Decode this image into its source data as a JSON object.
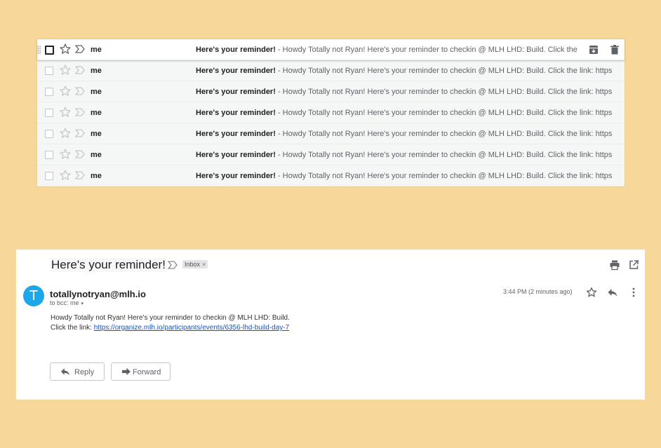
{
  "inbox": {
    "rows": [
      {
        "sender": "me",
        "subject": "Here's your reminder!",
        "snippet": " - Howdy Totally not Ryan! Here's your reminder to checkin @ MLH LHD: Build. Click the link: https://organize.mlh.io/participants/events/6356-lhd-build-day-7"
      },
      {
        "sender": "me",
        "subject": "Here's your reminder!",
        "snippet": " - Howdy Totally not Ryan! Here's your reminder to checkin @ MLH LHD: Build. Click the link: https://organize.mlh.io/participants/events/6356-lhd-build-day-7"
      },
      {
        "sender": "me",
        "subject": "Here's your reminder!",
        "snippet": " - Howdy Totally not Ryan! Here's your reminder to checkin @ MLH LHD: Build. Click the link: https://organize.mlh.io/participants/events/6356-lhd-build-day-7"
      },
      {
        "sender": "me",
        "subject": "Here's your reminder!",
        "snippet": " - Howdy Totally not Ryan! Here's your reminder to checkin @ MLH LHD: Build. Click the link: https://organize.mlh.io/participants/events/6356-lhd-build-day-7"
      },
      {
        "sender": "me",
        "subject": "Here's your reminder!",
        "snippet": " - Howdy Totally not Ryan! Here's your reminder to checkin @ MLH LHD: Build. Click the link: https://organize.mlh.io/participants/events/6356-lhd-build-day-7"
      },
      {
        "sender": "me",
        "subject": "Here's your reminder!",
        "snippet": " - Howdy Totally not Ryan! Here's your reminder to checkin @ MLH LHD: Build. Click the link: https://organize.mlh.io/participants/events/6356-lhd-build-day-7"
      },
      {
        "sender": "me",
        "subject": "Here's your reminder!",
        "snippet": " - Howdy Totally not Ryan! Here's your reminder to checkin @ MLH LHD: Build. Click the link: https://organize.mlh.io/participants/events/6356-lhd-build-day-7"
      }
    ]
  },
  "email": {
    "subject": "Here's your reminder!",
    "label": "Inbox",
    "label_remove": "×",
    "avatar_letter": "T",
    "from": "totallynotryan@mlh.io",
    "to": "to bcc: me",
    "to_caret": "▾",
    "time": "3:44 PM (2 minutes ago)",
    "body_line1": "Howdy Totally not Ryan! Here's your reminder to checkin @ MLH LHD: Build.",
    "body_line2_prefix": "Click the link: ",
    "link": "https://organize.mlh.io/participants/events/6356-lhd-build-day-7",
    "reply_label": "Reply",
    "forward_label": "Forward"
  },
  "colors": {
    "background": "#f8d79a",
    "avatar": "#1ea7e8",
    "link": "#1155cc"
  },
  "icons": [
    "drag-handle-icon",
    "checkbox",
    "star-icon",
    "importance-marker-icon",
    "archive-icon",
    "delete-icon",
    "print-icon",
    "open-in-new-window-icon",
    "reply-icon",
    "more-vert-icon",
    "forward-icon"
  ]
}
